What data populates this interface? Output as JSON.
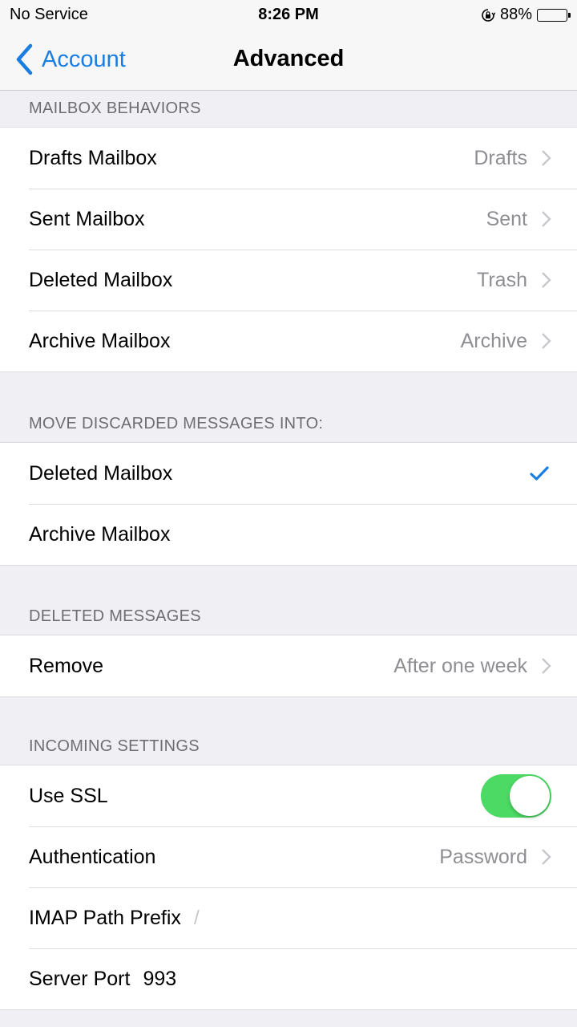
{
  "status_bar": {
    "carrier": "No Service",
    "time": "8:26 PM",
    "battery_percent": "88%",
    "battery_level": 0.88,
    "orientation_lock_icon": "orientation-lock-icon",
    "battery_icon": "battery-icon"
  },
  "nav": {
    "back_label": "Account",
    "title": "Advanced",
    "back_icon": "chevron-left-icon"
  },
  "colors": {
    "accent": "#1a7de1",
    "toggle_on": "#4cd964",
    "secondary_text": "#8e8e93",
    "section_header": "#6d6d72",
    "background": "#efeff4"
  },
  "sections": {
    "mailbox_behaviors": {
      "header": "MAILBOX BEHAVIORS",
      "rows": [
        {
          "label": "Drafts Mailbox",
          "value": "Drafts"
        },
        {
          "label": "Sent Mailbox",
          "value": "Sent"
        },
        {
          "label": "Deleted Mailbox",
          "value": "Trash"
        },
        {
          "label": "Archive Mailbox",
          "value": "Archive"
        }
      ]
    },
    "move_discarded": {
      "header": "MOVE DISCARDED MESSAGES INTO:",
      "rows": [
        {
          "label": "Deleted Mailbox",
          "selected": true
        },
        {
          "label": "Archive Mailbox",
          "selected": false
        }
      ]
    },
    "deleted_messages": {
      "header": "DELETED MESSAGES",
      "rows": [
        {
          "label": "Remove",
          "value": "After one week"
        }
      ]
    },
    "incoming_settings": {
      "header": "INCOMING SETTINGS",
      "use_ssl": {
        "label": "Use SSL",
        "on": true
      },
      "authentication": {
        "label": "Authentication",
        "value": "Password"
      },
      "imap_path_prefix": {
        "label": "IMAP Path Prefix",
        "placeholder": "/"
      },
      "server_port": {
        "label": "Server Port",
        "value": "993"
      }
    }
  }
}
